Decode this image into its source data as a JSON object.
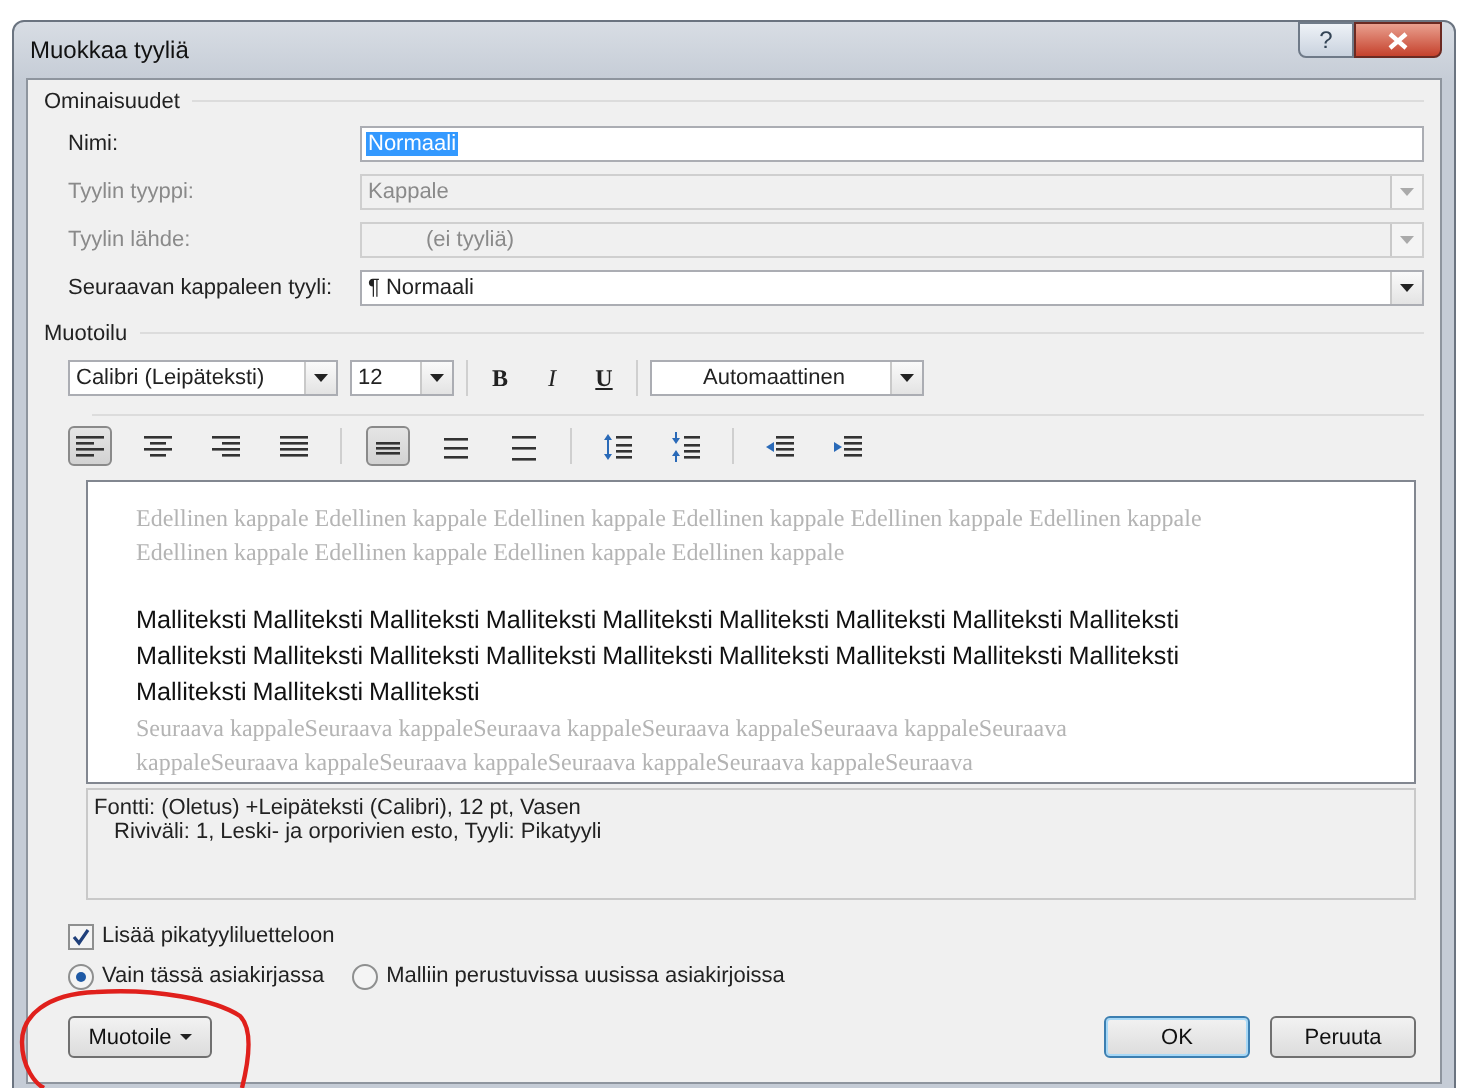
{
  "window": {
    "title": "Muokkaa tyyliä",
    "help": "?"
  },
  "properties": {
    "title": "Ominaisuudet",
    "fields": [
      {
        "kind": "text",
        "label": "Nimi:",
        "value": "Normaali",
        "highlighted": true,
        "disabled": false
      },
      {
        "kind": "dropdown",
        "label": "Tyylin tyyppi:",
        "value": "Kappale",
        "disabled": true
      },
      {
        "kind": "dropdown",
        "label": "Tyylin lähde:",
        "value": "(ei tyyliä)",
        "disabled": true
      },
      {
        "kind": "dropdown",
        "label": "Seuraavan kappaleen tyyli:",
        "mark": "¶",
        "value": "Normaali",
        "disabled": false
      }
    ]
  },
  "formatting": {
    "title": "Muotoilu",
    "font": "Calibri (Leipäteksti)",
    "size": "12",
    "bold": "B",
    "italic": "I",
    "underline": "U",
    "font_color": "Automaattinen",
    "alignment": [
      {
        "kind": "left",
        "selected": true
      },
      {
        "kind": "center",
        "selected": false
      },
      {
        "kind": "right",
        "selected": false
      },
      {
        "kind": "justify",
        "selected": false
      }
    ],
    "spacing": [
      {
        "kind": "single",
        "selected": true
      },
      {
        "kind": "onehalf",
        "selected": false
      },
      {
        "kind": "double",
        "selected": false
      }
    ],
    "paragraph_spacing": [
      {
        "kind": "increase"
      },
      {
        "kind": "decrease"
      }
    ],
    "indent": [
      {
        "kind": "decrease"
      },
      {
        "kind": "increase"
      }
    ]
  },
  "preview": {
    "previous": "Edellinen kappale Edellinen kappale Edellinen kappale Edellinen kappale Edellinen kappale Edellinen kappale Edellinen kappale Edellinen kappale Edellinen kappale Edellinen kappale",
    "sample": "Malliteksti Malliteksti Malliteksti Malliteksti Malliteksti Malliteksti Malliteksti Malliteksti Malliteksti Malliteksti Malliteksti Malliteksti Malliteksti Malliteksti Malliteksti Malliteksti Malliteksti Malliteksti Malliteksti Malliteksti Malliteksti",
    "next": "Seuraava kappaleSeuraava kappaleSeuraava kappaleSeuraava kappaleSeuraava kappaleSeuraava kappaleSeuraava kappaleSeuraava kappaleSeuraava kappaleSeuraava kappaleSeuraava"
  },
  "description": [
    "Fontti: (Oletus) +Leipäteksti (Calibri), 12 pt, Vasen",
    "Riviväli:  1, Leski- ja orporivien esto, Tyyli: Pikatyyli"
  ],
  "quick_style": {
    "label": "Lisää pikatyyliluetteloon",
    "checked": true
  },
  "scope": [
    {
      "label": "Vain tässä asiakirjassa",
      "selected": true
    },
    {
      "label": "Malliin perustuvissa uusissa asiakirjoissa",
      "selected": false
    }
  ],
  "buttons": [
    {
      "kind": "menu",
      "label": "Muotoile"
    },
    {
      "kind": "default",
      "label": "OK"
    },
    {
      "kind": "normal",
      "label": "Peruuta"
    }
  ],
  "annotation": {
    "kind": "ellipse"
  }
}
